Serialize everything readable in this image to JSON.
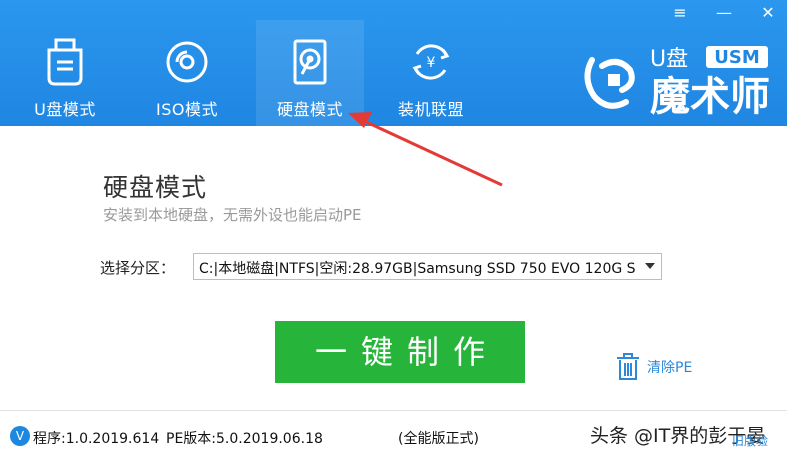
{
  "window_controls": {
    "menu": "≡",
    "minimize": "—",
    "close": "✕"
  },
  "tabs": [
    {
      "label": "U盘模式",
      "icon": "usb-drive-icon"
    },
    {
      "label": "ISO模式",
      "icon": "disc-icon"
    },
    {
      "label": "硬盘模式",
      "icon": "hard-drive-icon",
      "active": true
    },
    {
      "label": "装机联盟",
      "icon": "yen-cycle-icon"
    }
  ],
  "logo": {
    "brand_top": "U盘",
    "badge": "USM",
    "brand_main": "魔术师"
  },
  "main": {
    "title": "硬盘模式",
    "subtitle": "安装到本地硬盘，无需外设也能启动PE",
    "partition_label": "选择分区：",
    "partition_value": "C:|本地磁盘|NTFS|空闲:28.97GB|Samsung SSD 750 EVO 120G S",
    "action_button": "一键制作",
    "clear_pe": "清除PE"
  },
  "footer": {
    "badge": "V",
    "program_version": "程序:1.0.2019.614",
    "pe_version": "PE版本:5.0.2019.06.18",
    "edition": "(全能版正式)",
    "watermark": "头条 @IT界的彭于晏",
    "old_version": "旧版验"
  },
  "colors": {
    "header_blue": "#2093e8",
    "button_green": "#27b43a",
    "link_blue": "#2d88d8",
    "arrow_red": "#e53935"
  }
}
